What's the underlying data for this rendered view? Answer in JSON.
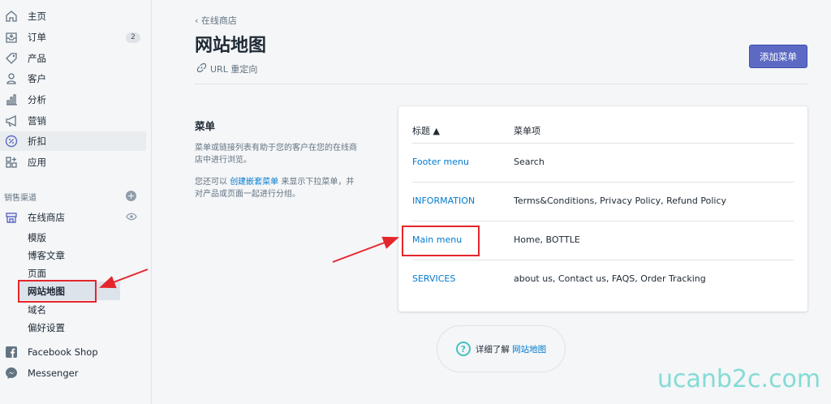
{
  "sidebar": {
    "items": [
      {
        "label": "主页",
        "icon": "home-icon"
      },
      {
        "label": "订单",
        "icon": "orders-icon",
        "badge": "2"
      },
      {
        "label": "产品",
        "icon": "tag-icon"
      },
      {
        "label": "客户",
        "icon": "person-icon"
      },
      {
        "label": "分析",
        "icon": "chart-icon"
      },
      {
        "label": "营销",
        "icon": "megaphone-icon"
      },
      {
        "label": "折扣",
        "icon": "discount-icon"
      },
      {
        "label": "应用",
        "icon": "apps-icon"
      }
    ],
    "sales_channels_title": "销售渠道",
    "online_store": "在线商店",
    "sub_items": [
      "模版",
      "博客文章",
      "页面",
      "网站地图",
      "域名",
      "偏好设置"
    ],
    "facebook": "Facebook Shop",
    "messenger": "Messenger"
  },
  "header": {
    "back": "在线商店",
    "title": "网站地图",
    "url_redirect": "URL 重定向",
    "add_menu": "添加菜单"
  },
  "menu_section": {
    "heading": "菜单",
    "desc1": "菜单或链接列表有助于您的客户在您的在线商店中进行浏览。",
    "desc2_pre": "您还可以 ",
    "desc2_link": "创建嵌套菜单",
    "desc2_post": " 来显示下拉菜单，并对产品或页面一起进行分组。"
  },
  "table": {
    "col_title": "标题 ▲",
    "col_items": "菜单项",
    "rows": [
      {
        "title": "Footer menu",
        "items": "Search"
      },
      {
        "title": "INFORMATION",
        "items": "Terms&Conditions, Privacy Policy, Refund Policy"
      },
      {
        "title": "Main menu",
        "items": "Home, BOTTLE"
      },
      {
        "title": "SERVICES",
        "items": "about us, Contact us, FAQS, Order Tracking"
      }
    ]
  },
  "learn_more": {
    "pre": "详细了解 ",
    "link": "网站地图"
  },
  "watermark": "ucanb2c.com",
  "colors": {
    "accent": "#5c6ac4",
    "link": "#007ace",
    "highlight": "#e4262c"
  }
}
